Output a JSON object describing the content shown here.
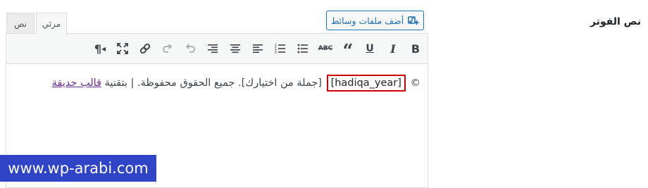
{
  "field": {
    "label": "نص الفوتر"
  },
  "media_button": {
    "label": "أضف ملفات وسائط",
    "icon": "add-media-icon"
  },
  "tabs": [
    {
      "label": "مرئي",
      "active": true
    },
    {
      "label": "نص",
      "active": false
    }
  ],
  "toolbar": {
    "buttons": [
      {
        "name": "bold",
        "glyph": "B"
      },
      {
        "name": "italic",
        "glyph": "I"
      },
      {
        "name": "underline",
        "glyph": "U"
      },
      {
        "name": "blockquote",
        "glyph": "“"
      },
      {
        "name": "strikethrough",
        "glyph": "ABC"
      },
      {
        "name": "bulleted-list"
      },
      {
        "name": "numbered-list"
      },
      {
        "name": "align-left"
      },
      {
        "name": "align-center"
      },
      {
        "name": "align-right"
      },
      {
        "name": "undo"
      },
      {
        "name": "redo"
      },
      {
        "name": "link"
      },
      {
        "name": "fullscreen"
      },
      {
        "name": "paragraph-direction",
        "glyph": "¶"
      }
    ]
  },
  "content": {
    "copyright": "©",
    "shortcode": "[hadiqa_year]",
    "text": "[جملة من اختيارك]. جميع الحقوق محفوظة. | بتقنية",
    "link": "قالب حديقة"
  },
  "watermark": {
    "text": "www.wp-arabi.com"
  },
  "colors": {
    "accent": "#2271b1",
    "highlight_border": "#d00000",
    "link": "#6b2d8c",
    "watermark_bg": "#2f44c6"
  }
}
